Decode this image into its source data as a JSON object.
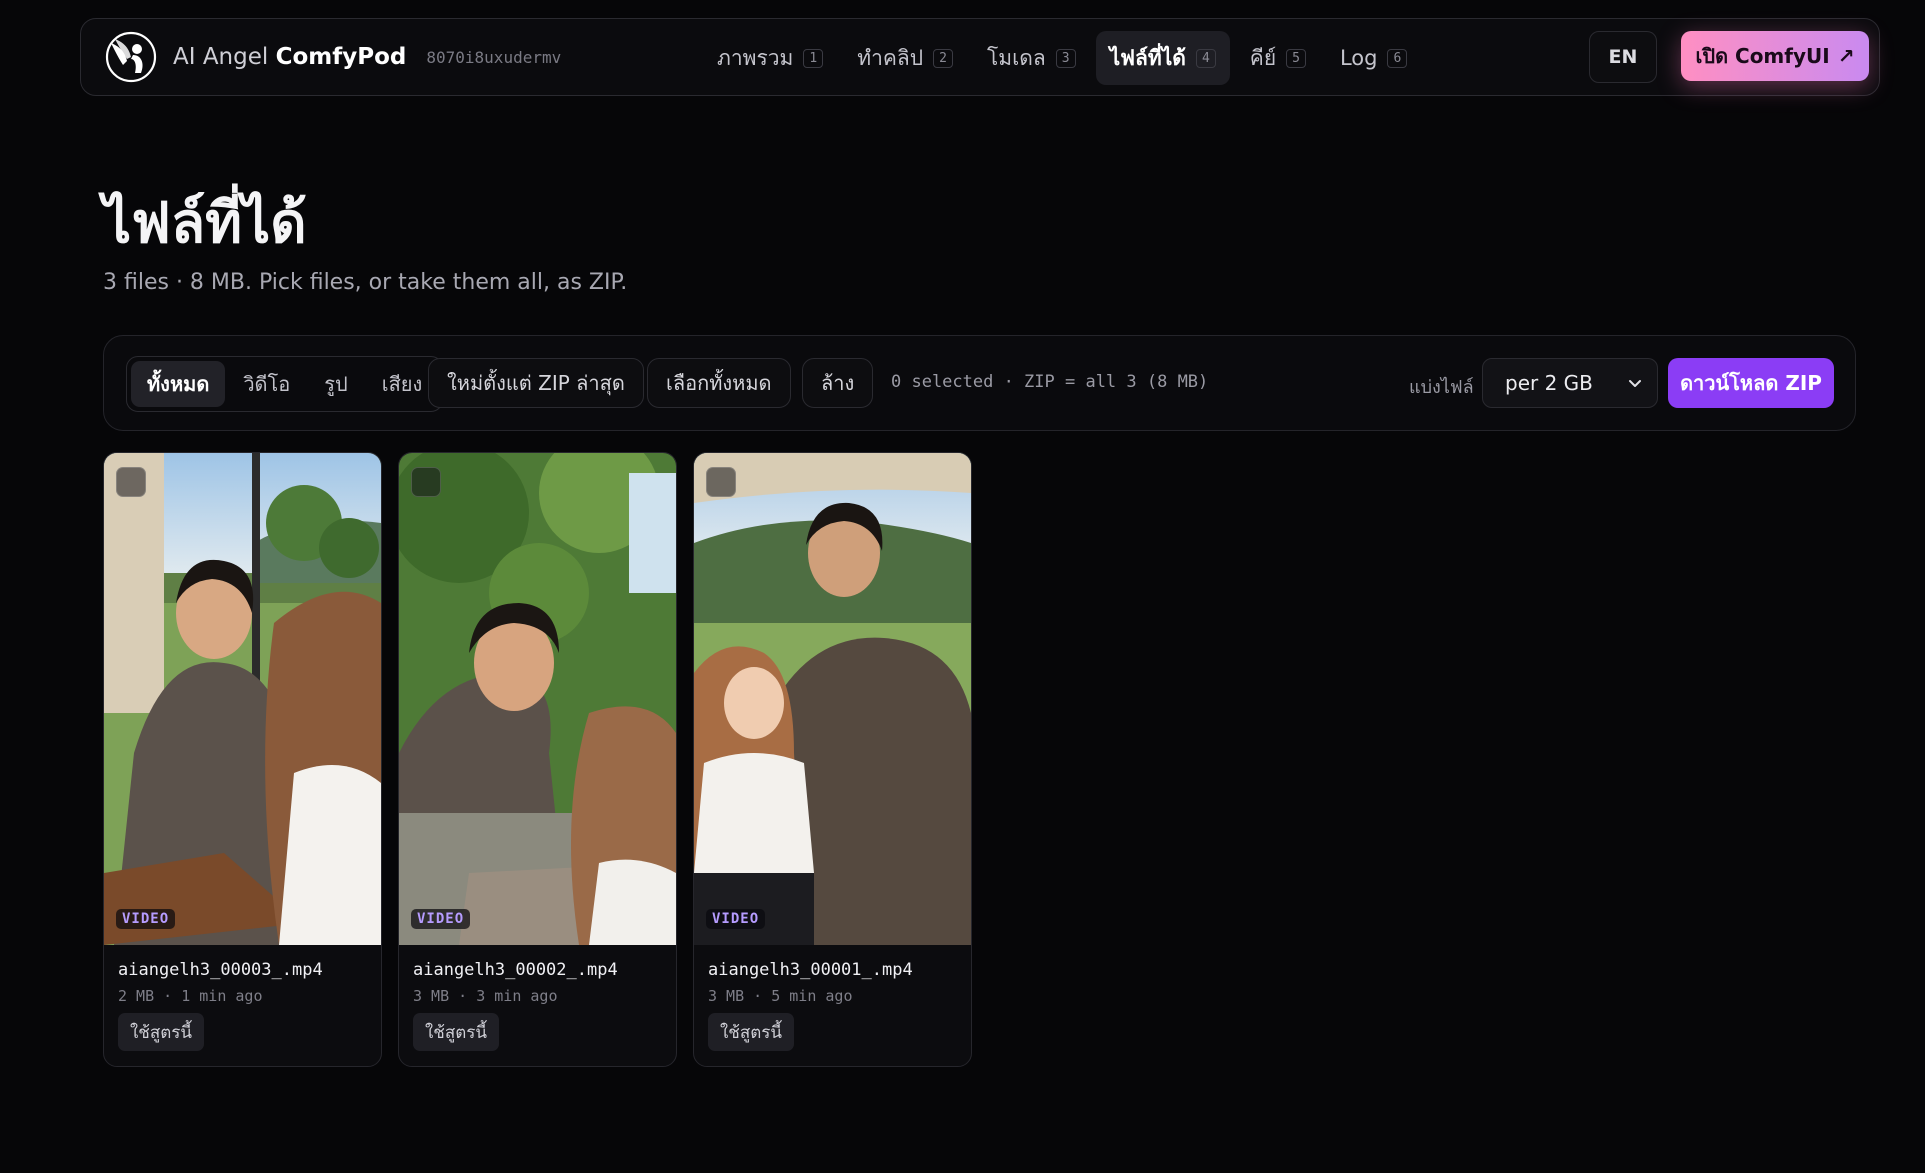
{
  "header": {
    "brand_prefix": "AI Angel ",
    "brand_name": "ComfyPod",
    "instance_id": "8070i8uxudermv",
    "tabs": [
      {
        "label": "ภาพรวม",
        "key": "1"
      },
      {
        "label": "ทำคลิป",
        "key": "2"
      },
      {
        "label": "โมเดล",
        "key": "3"
      },
      {
        "label": "ไฟล์ที่ได้",
        "key": "4",
        "active": true
      },
      {
        "label": "คีย์",
        "key": "5"
      },
      {
        "label": "Log",
        "key": "6"
      }
    ],
    "language": "EN",
    "open_comfy_label": "เปิด ComfyUI",
    "open_comfy_arrow": "↗",
    "accent_gradient": [
      "#ff8fc2",
      "#c98af0"
    ]
  },
  "main": {
    "title": "ไฟล์ที่ได้",
    "subtitle": "3 files · 8 MB. Pick files, or take them all, as ZIP."
  },
  "toolbar": {
    "filters": [
      {
        "label": "ทั้งหมด",
        "active": true
      },
      {
        "label": "วิดีโอ"
      },
      {
        "label": "รูป"
      },
      {
        "label": "เสียง"
      }
    ],
    "new_since_zip_label": "ใหม่ตั้งแต่ ZIP ล่าสุด",
    "select_all_label": "เลือกทั้งหมด",
    "clear_label": "ล้าง",
    "selection_status": "0 selected · ZIP = all 3 (8 MB)",
    "split_label": "แบ่งไฟล์",
    "split_value": "per 2 GB",
    "download_zip_label": "ดาวน์โหลด ZIP",
    "download_color": "#8b3df5"
  },
  "files": [
    {
      "name": "aiangelh3_00003_.mp4",
      "meta": "2 MB · 1 min ago",
      "type": "VIDEO",
      "action": "ใช้สูตรนี้"
    },
    {
      "name": "aiangelh3_00002_.mp4",
      "meta": "3 MB · 3 min ago",
      "type": "VIDEO",
      "action": "ใช้สูตรนี้"
    },
    {
      "name": "aiangelh3_00001_.mp4",
      "meta": "3 MB · 5 min ago",
      "type": "VIDEO",
      "action": "ใช้สูตรนี้"
    }
  ]
}
